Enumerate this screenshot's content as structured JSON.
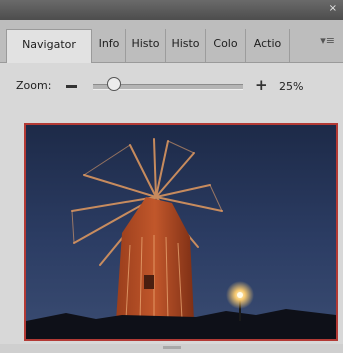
{
  "panel": {
    "close_glyph": "×",
    "tabs": [
      {
        "label": "Navigator"
      },
      {
        "label": "Info"
      },
      {
        "label": "Histo"
      },
      {
        "label": "Histo"
      },
      {
        "label": "Colo"
      },
      {
        "label": "Actio"
      }
    ],
    "menu_glyph": "▾≡"
  },
  "zoom": {
    "label": "Zoom:",
    "minus_icon": "minus-icon",
    "plus_glyph": "+",
    "value": "25%",
    "slider_level": 0.14
  },
  "preview": {
    "frame_color": "#b33a35",
    "content": "windmill-photo"
  }
}
